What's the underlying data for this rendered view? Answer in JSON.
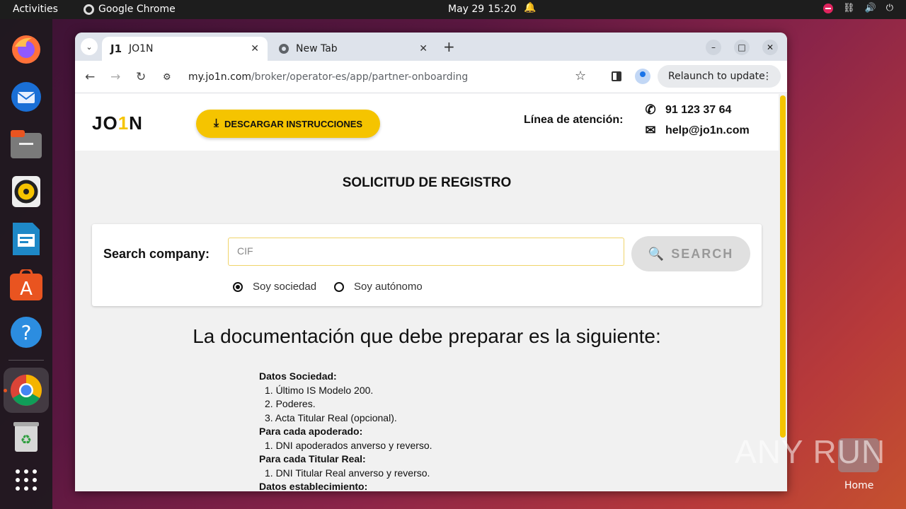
{
  "topbar": {
    "activities": "Activities",
    "app_name": "Google Chrome",
    "date": "May 29",
    "time": "15:20"
  },
  "dock": {
    "apps": [
      "firefox-icon",
      "thunderbird-icon",
      "files-icon",
      "rhythmbox-icon",
      "writer-icon",
      "app-center-icon",
      "help-icon",
      "chrome-icon",
      "trash-icon",
      "show-apps-icon"
    ]
  },
  "browser": {
    "tabs": [
      {
        "label": "JO1N",
        "favicon": "J1"
      },
      {
        "label": "New Tab"
      }
    ],
    "url_host": "my.jo1n.com",
    "url_path": "/broker/operator-es/app/partner-onboarding",
    "relaunch_label": "Relaunch to update"
  },
  "page": {
    "logo": {
      "pre": "JO",
      "mid": "1",
      "post": "N"
    },
    "download_label": "DESCARGAR INSTRUCCIONES",
    "atencion_label": "Línea de atención:",
    "phone": "91 123 37 64",
    "email": "help@jo1n.com",
    "title": "SOLICITUD DE REGISTRO",
    "search_label": "Search company:",
    "search_placeholder": "CIF",
    "search_button": "SEARCH",
    "radio_sociedad": "Soy sociedad",
    "radio_autonomo": "Soy autónomo",
    "doc_title": "La documentación que debe preparar es la siguiente:",
    "sections": [
      {
        "heading": "Datos Sociedad:",
        "items": [
          "1. Último IS Modelo 200.",
          "2. Poderes.",
          "3. Acta Titular Real (opcional)."
        ]
      },
      {
        "heading": "Para cada apoderado:",
        "items": [
          "1. DNI apoderados anverso y reverso."
        ]
      },
      {
        "heading": "Para cada Titular Real:",
        "items": [
          "1. DNI Titular Real anverso y reverso."
        ]
      },
      {
        "heading": "Datos establecimiento:",
        "items": []
      }
    ]
  },
  "watermark": {
    "text": "ANY RUN",
    "home_label": "Home"
  },
  "colors": {
    "accent": "#f5c400",
    "ubuntu_orange": "#e95420"
  }
}
